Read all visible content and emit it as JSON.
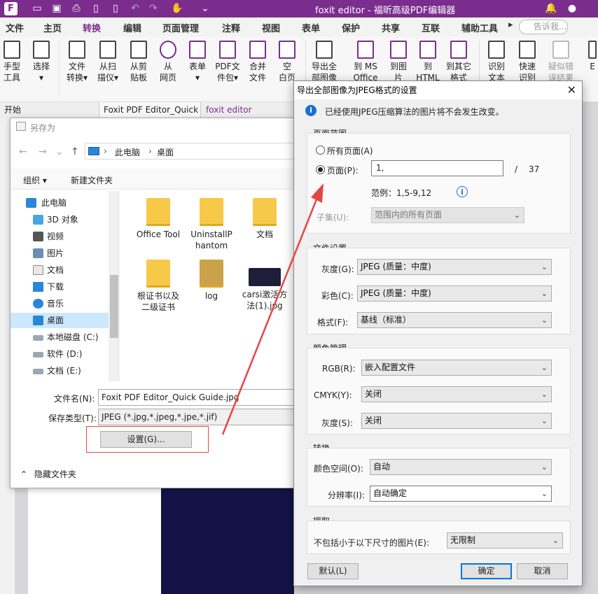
{
  "app": {
    "title": "foxit editor - 福昕高级PDF编辑器",
    "accent": "#7b2d8e"
  },
  "ribbon_tabs": [
    "文件",
    "主页",
    "转换",
    "编辑",
    "页面管理",
    "注释",
    "视图",
    "表单",
    "保护",
    "共享",
    "互联",
    "辅助工具"
  ],
  "active_tab": "转换",
  "search_placeholder": "告诉我...",
  "ribbon_buttons": [
    {
      "label1": "手型",
      "label2": "工具"
    },
    {
      "label1": "选择",
      "label2": "▾"
    },
    {
      "label1": "文件",
      "label2": "转换▾"
    },
    {
      "label1": "从扫",
      "label2": "描仪▾"
    },
    {
      "label1": "从剪",
      "label2": "贴板"
    },
    {
      "label1": "从",
      "label2": "网页"
    },
    {
      "label1": "表单",
      "label2": "▾"
    },
    {
      "label1": "PDF文",
      "label2": "件包▾"
    },
    {
      "label1": "合并",
      "label2": "文件"
    },
    {
      "label1": "空",
      "label2": "白页"
    },
    {
      "label1": "导出全",
      "label2": "部图像"
    },
    {
      "label1": "到 MS",
      "label2": "Office"
    },
    {
      "label1": "到图",
      "label2": "片"
    },
    {
      "label1": "到",
      "label2": "HTML"
    },
    {
      "label1": "到其它",
      "label2": "格式"
    },
    {
      "label1": "识别",
      "label2": "文本"
    },
    {
      "label1": "快速",
      "label2": "识别"
    },
    {
      "label1": "疑似错",
      "label2": "误结果"
    },
    {
      "label1": "E",
      "label2": ""
    }
  ],
  "doc_tabs": [
    "开始",
    "Foxit PDF Editor_Quick ...",
    "foxit editor"
  ],
  "save_as": {
    "title": "另存为",
    "breadcrumb": [
      "此电脑",
      "桌面"
    ],
    "organize": "组织 ▾",
    "new_folder": "新建文件夹",
    "tree": [
      {
        "label": "此电脑",
        "icon": "pc-icon"
      },
      {
        "label": "3D 对象",
        "icon": "3d-objects-icon"
      },
      {
        "label": "视频",
        "icon": "video-icon"
      },
      {
        "label": "图片",
        "icon": "pictures-icon"
      },
      {
        "label": "文档",
        "icon": "documents-icon"
      },
      {
        "label": "下载",
        "icon": "download-icon"
      },
      {
        "label": "音乐",
        "icon": "music-icon"
      },
      {
        "label": "桌面",
        "icon": "desktop-icon",
        "selected": true
      },
      {
        "label": "本地磁盘 (C:)",
        "icon": "drive-icon"
      },
      {
        "label": "软件 (D:)",
        "icon": "drive-icon"
      },
      {
        "label": "文档 (E:)",
        "icon": "drive-icon"
      }
    ],
    "files": [
      {
        "name": "Office Tool"
      },
      {
        "name": "UninstallPhantom"
      },
      {
        "name": "文档"
      },
      {
        "name": "根证书以及二级证书"
      },
      {
        "name": "log"
      },
      {
        "name": "carsi激活方法(1).jpg"
      }
    ],
    "filename_label": "文件名(N):",
    "filename_value": "Foxit PDF Editor_Quick Guide.jpg",
    "filetype_label": "保存类型(T):",
    "filetype_value": "JPEG (*.jpg,*.jpeg,*.jpe,*.jif)",
    "settings_button": "设置(G)...",
    "hide_folders": "隐藏文件夹"
  },
  "jpeg_dialog": {
    "title": "导出全部图像为JPEG格式的设置",
    "info": "已经使用JPEG压缩算法的图片将不会发生改变。",
    "page_range": {
      "legend": "页面范围",
      "all_pages": "所有页面(A)",
      "pages": "页面(P):",
      "pages_value": "1,",
      "separator": "/",
      "total": "37",
      "example": "范例：1,5-9,12",
      "subset_label": "子集(U):",
      "subset_value": "范围内的所有页面"
    },
    "file_settings": {
      "legend": "文件设置",
      "gray_label": "灰度(G):",
      "gray_value": "JPEG (质量：中度)",
      "color_label": "彩色(C):",
      "color_value": "JPEG (质量：中度)",
      "format_label": "格式(F):",
      "format_value": "基线（标准）"
    },
    "color_mgmt": {
      "legend": "颜色管理",
      "rgb_label": "RGB(R):",
      "rgb_value": "嵌入配置文件",
      "cmyk_label": "CMYK(Y):",
      "cmyk_value": "关闭",
      "gray_label": "灰度(S):",
      "gray_value": "关闭"
    },
    "convert": {
      "legend": "转换",
      "colorspace_label": "颜色空间(O):",
      "colorspace_value": "自动",
      "resolution_label": "分辨率(I):",
      "resolution_value": "自动确定"
    },
    "extract": {
      "legend": "提取",
      "exclude_label": "不包括小于以下尺寸的图片(E):",
      "exclude_value": "无限制"
    },
    "buttons": {
      "default": "默认(L)",
      "ok": "确定",
      "cancel": "取消"
    }
  },
  "annotation_color": "#e64545"
}
